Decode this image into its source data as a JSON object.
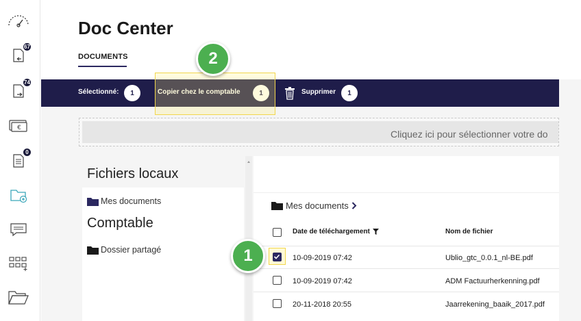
{
  "sidebar": {
    "items": [
      {
        "icon": "speedometer-icon",
        "badge": ""
      },
      {
        "icon": "incoming-document-icon",
        "badge": "67"
      },
      {
        "icon": "outgoing-document-icon",
        "badge": "74"
      },
      {
        "icon": "euro-bill-icon",
        "badge": ""
      },
      {
        "icon": "list-document-icon",
        "badge": "0"
      },
      {
        "icon": "folder-add-icon",
        "badge": ""
      },
      {
        "icon": "chat-icon",
        "badge": ""
      },
      {
        "icon": "apps-grid-icon",
        "badge": ""
      },
      {
        "icon": "open-folder-icon",
        "badge": ""
      }
    ]
  },
  "header": {
    "title": "Doc Center",
    "tab": "DOCUMENTS"
  },
  "actionbar": {
    "selected_label": "Sélectionné:",
    "selected_count": "1",
    "copy_label": "Copier chez le comptable",
    "copy_count": "1",
    "delete_label": "Supprimer",
    "delete_count": "1"
  },
  "steps": {
    "one": "1",
    "two": "2"
  },
  "dropzone": {
    "text": "Cliquez ici pour sélectionner votre do"
  },
  "left_panel": {
    "local_title": "Fichiers locaux",
    "local_folder": "Mes documents",
    "accountant_title": "Comptable",
    "shared_folder": "Dossier partagé"
  },
  "right_panel": {
    "breadcrumb": "Mes documents",
    "columns": {
      "date": "Date de téléchargement",
      "filename": "Nom de fichier"
    },
    "rows": [
      {
        "date": "10-09-2019 07:42",
        "filename": "Ublio_gtc_0.0.1_nl-BE.pdf",
        "checked": true
      },
      {
        "date": "10-09-2019 07:42",
        "filename": "ADM Factuurherkenning.pdf",
        "checked": false
      },
      {
        "date": "20-11-2018 20:55",
        "filename": "Jaarrekening_baaik_2017.pdf",
        "checked": false
      }
    ]
  },
  "colors": {
    "navy": "#1f1d4a",
    "accent_teal": "#3aa6b9",
    "step_green": "#4caf50",
    "highlight_yellow": "#f2d64b"
  }
}
